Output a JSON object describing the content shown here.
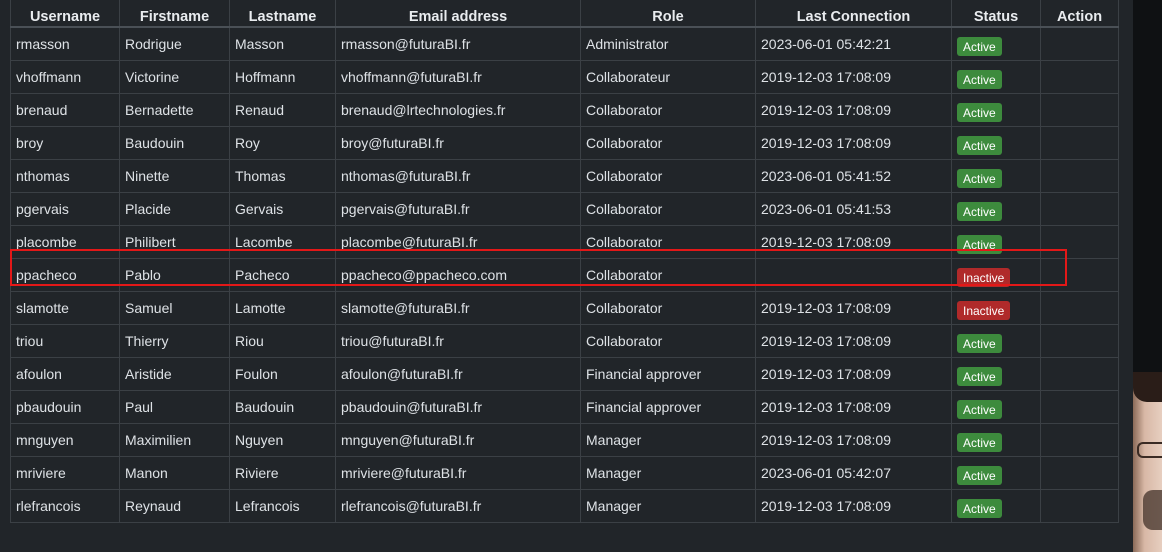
{
  "columns": [
    "Username",
    "Firstname",
    "Lastname",
    "Email address",
    "Role",
    "Last Connection",
    "Status",
    "Action"
  ],
  "users": [
    {
      "username": "rmasson",
      "firstname": "Rodrigue",
      "lastname": "Masson",
      "email": "rmasson@futuraBI.fr",
      "role": "Administrator",
      "last_connection": "2023-06-01 05:42:21",
      "status": "Active"
    },
    {
      "username": "vhoffmann",
      "firstname": "Victorine",
      "lastname": "Hoffmann",
      "email": "vhoffmann@futuraBI.fr",
      "role": "Collaborateur",
      "last_connection": "2019-12-03 17:08:09",
      "status": "Active"
    },
    {
      "username": "brenaud",
      "firstname": "Bernadette",
      "lastname": "Renaud",
      "email": "brenaud@lrtechnologies.fr",
      "role": "Collaborator",
      "last_connection": "2019-12-03 17:08:09",
      "status": "Active"
    },
    {
      "username": "broy",
      "firstname": "Baudouin",
      "lastname": "Roy",
      "email": "broy@futuraBI.fr",
      "role": "Collaborator",
      "last_connection": "2019-12-03 17:08:09",
      "status": "Active"
    },
    {
      "username": "nthomas",
      "firstname": "Ninette",
      "lastname": "Thomas",
      "email": "nthomas@futuraBI.fr",
      "role": "Collaborator",
      "last_connection": "2023-06-01 05:41:52",
      "status": "Active"
    },
    {
      "username": "pgervais",
      "firstname": "Placide",
      "lastname": "Gervais",
      "email": "pgervais@futuraBI.fr",
      "role": "Collaborator",
      "last_connection": "2023-06-01 05:41:53",
      "status": "Active"
    },
    {
      "username": "placombe",
      "firstname": "Philibert",
      "lastname": "Lacombe",
      "email": "placombe@futuraBI.fr",
      "role": "Collaborator",
      "last_connection": "2019-12-03 17:08:09",
      "status": "Active"
    },
    {
      "username": "ppacheco",
      "firstname": "Pablo",
      "lastname": "Pacheco",
      "email": "ppacheco@ppacheco.com",
      "role": "Collaborator",
      "last_connection": "",
      "status": "Inactive"
    },
    {
      "username": "slamotte",
      "firstname": "Samuel",
      "lastname": "Lamotte",
      "email": "slamotte@futuraBI.fr",
      "role": "Collaborator",
      "last_connection": "2019-12-03 17:08:09",
      "status": "Inactive"
    },
    {
      "username": "triou",
      "firstname": "Thierry",
      "lastname": "Riou",
      "email": "triou@futuraBI.fr",
      "role": "Collaborator",
      "last_connection": "2019-12-03 17:08:09",
      "status": "Active"
    },
    {
      "username": "afoulon",
      "firstname": "Aristide",
      "lastname": "Foulon",
      "email": "afoulon@futuraBI.fr",
      "role": "Financial approver",
      "last_connection": "2019-12-03 17:08:09",
      "status": "Active"
    },
    {
      "username": "pbaudouin",
      "firstname": "Paul",
      "lastname": "Baudouin",
      "email": "pbaudouin@futuraBI.fr",
      "role": "Financial approver",
      "last_connection": "2019-12-03 17:08:09",
      "status": "Active"
    },
    {
      "username": "mnguyen",
      "firstname": "Maximilien",
      "lastname": "Nguyen",
      "email": "mnguyen@futuraBI.fr",
      "role": "Manager",
      "last_connection": "2019-12-03 17:08:09",
      "status": "Active"
    },
    {
      "username": "mriviere",
      "firstname": "Manon",
      "lastname": "Riviere",
      "email": "mriviere@futuraBI.fr",
      "role": "Manager",
      "last_connection": "2023-06-01 05:42:07",
      "status": "Active"
    },
    {
      "username": "rlefrancois",
      "firstname": "Reynaud",
      "lastname": "Lefrancois",
      "email": "rlefrancois@futuraBI.fr",
      "role": "Manager",
      "last_connection": "2019-12-03 17:08:09",
      "status": "Active"
    }
  ],
  "colors": {
    "active": "#3d8b3d",
    "inactive": "#b02a2a",
    "highlight": "#e31818",
    "background": "#212529"
  }
}
